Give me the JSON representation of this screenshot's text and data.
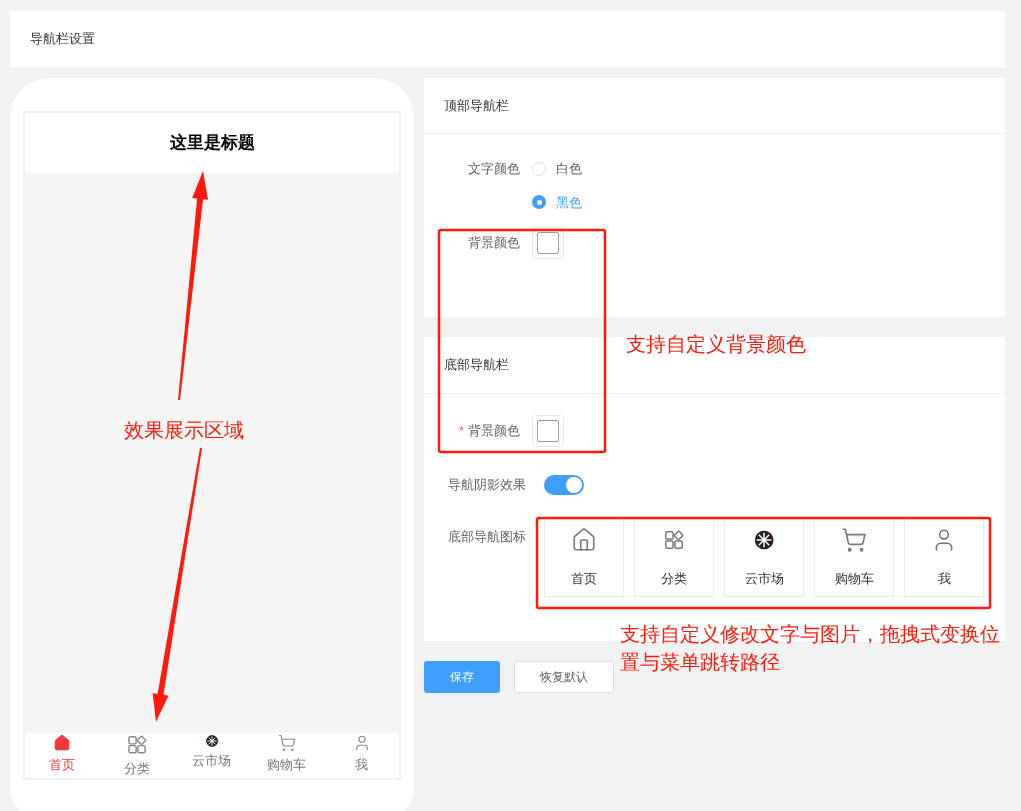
{
  "page_title": "导航栏设置",
  "phone": {
    "title": "这里是标题",
    "tabbar": [
      {
        "label": "首页",
        "selected": true
      },
      {
        "label": "分类",
        "selected": false
      },
      {
        "label": "云市场",
        "selected": false
      },
      {
        "label": "购物车",
        "selected": false
      },
      {
        "label": "我",
        "selected": false
      }
    ]
  },
  "top_nav": {
    "title": "顶部导航栏",
    "text_color_label": "文字颜色",
    "text_color_options": [
      {
        "label": "白色",
        "selected": false
      },
      {
        "label": "黑色",
        "selected": true
      }
    ],
    "bg_color_label": "背景颜色"
  },
  "bottom_nav": {
    "title": "底部导航栏",
    "bg_color_label": "背景颜色",
    "required_mark": "*",
    "shadow_label": "导航阴影效果",
    "shadow_on": true,
    "icons_label": "底部导航图标",
    "icons": [
      {
        "label": "首页"
      },
      {
        "label": "分类"
      },
      {
        "label": "云市场"
      },
      {
        "label": "购物车"
      },
      {
        "label": "我"
      }
    ]
  },
  "buttons": [
    {
      "label": "保存",
      "kind": "primary"
    },
    {
      "label": "恢复默认",
      "kind": "default"
    }
  ],
  "annotations": [
    "效果展示区域",
    "支持自定义背景颜色",
    "支持自定义修改文字与图片，拖拽式变换位置与菜单跳转路径"
  ]
}
